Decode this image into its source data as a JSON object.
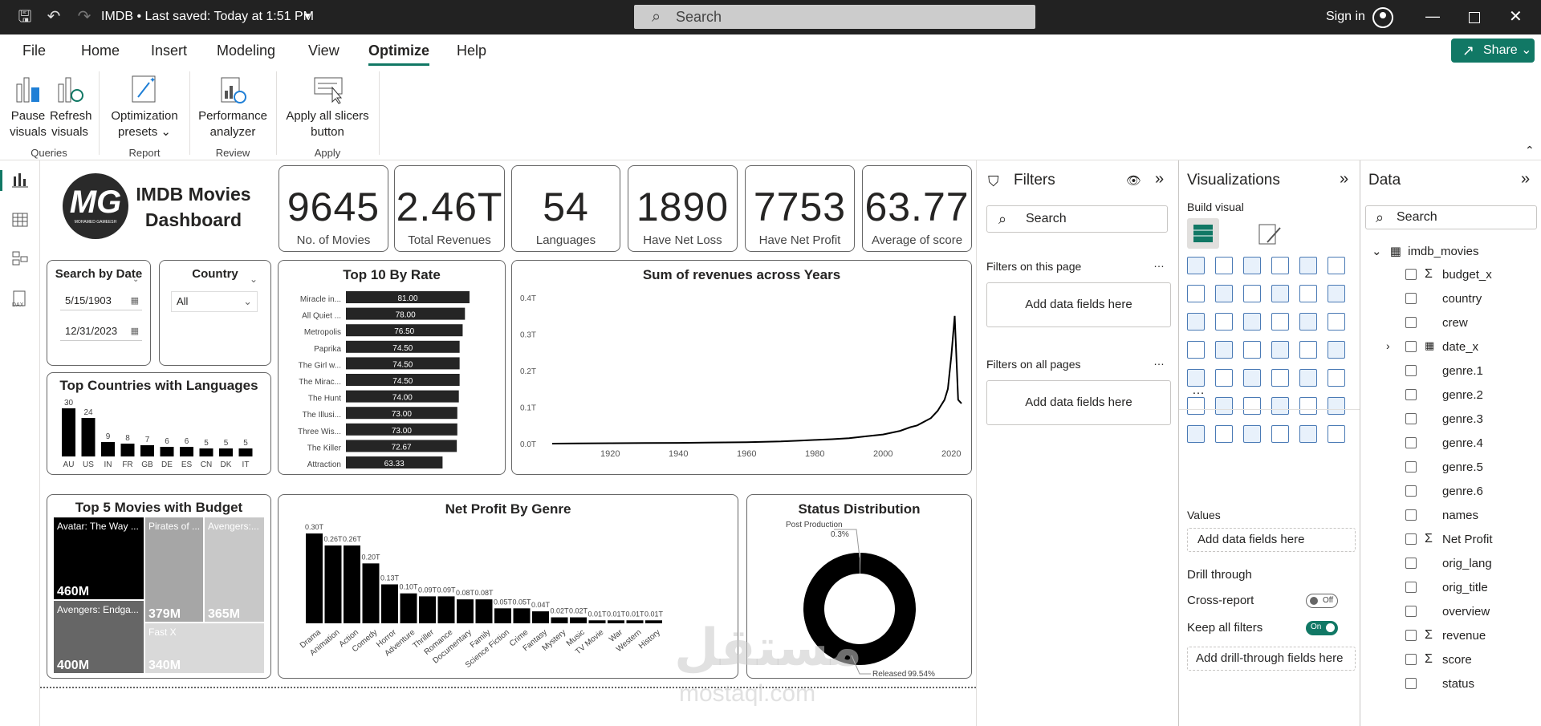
{
  "app": {
    "title": "IMDB • Last saved: Today at 1:51 PM",
    "search_placeholder": "Search",
    "signin": "Sign in"
  },
  "menu": {
    "items": [
      "File",
      "Home",
      "Insert",
      "Modeling",
      "View",
      "Optimize",
      "Help"
    ],
    "active": "Optimize",
    "share": "Share"
  },
  "ribbon": {
    "buttons": [
      {
        "line1": "Pause",
        "line2": "visuals"
      },
      {
        "line1": "Refresh",
        "line2": "visuals"
      },
      {
        "line1": "Optimization",
        "line2": "presets"
      },
      {
        "line1": "Performance",
        "line2": "analyzer"
      },
      {
        "line1": "Apply all slicers",
        "line2": "button"
      }
    ],
    "groups": [
      "Queries",
      "Report",
      "Review",
      "Apply"
    ]
  },
  "report": {
    "logo": {
      "letters": "MG",
      "subtext": "MOHAMED GAMEESH"
    },
    "title_line1": "IMDB Movies",
    "title_line2": "Dashboard",
    "kpis": [
      {
        "value": "9645",
        "label": "No. of Movies"
      },
      {
        "value": "2.46T",
        "label": "Total Revenues"
      },
      {
        "value": "54",
        "label": "Languages"
      },
      {
        "value": "1890",
        "label": "Have Net Loss"
      },
      {
        "value": "7753",
        "label": "Have Net Profit"
      },
      {
        "value": "63.77",
        "label": "Average of score"
      }
    ],
    "date_slicer": {
      "title": "Search by Date",
      "start": "5/15/1903",
      "end": "12/31/2023"
    },
    "country_slicer": {
      "title": "Country",
      "value": "All"
    }
  },
  "chart_data": [
    {
      "type": "bar",
      "orientation": "horizontal",
      "title": "Top 10 By Rate",
      "categories": [
        "Miracle in...",
        "All Quiet ...",
        "Metropolis",
        "Paprika",
        "The Girl w...",
        "The Mirac...",
        "The Hunt",
        "The Illusi...",
        "Three Wis...",
        "The Killer",
        "Attraction"
      ],
      "values": [
        81.0,
        78.0,
        76.5,
        74.5,
        74.5,
        74.5,
        74.0,
        73.0,
        73.0,
        72.67,
        63.33
      ],
      "labels": [
        "81.00",
        "78.00",
        "76.50",
        "74.50",
        "74.50",
        "74.50",
        "74.00",
        "73.00",
        "73.00",
        "72.67",
        "63.33"
      ],
      "color": "#252525"
    },
    {
      "type": "line",
      "title": "Sum of revenues across Years",
      "yticks": [
        "0.0T",
        "0.1T",
        "0.2T",
        "0.3T",
        "0.4T"
      ],
      "xticks": [
        "1920",
        "1940",
        "1960",
        "1980",
        "2000",
        "2020"
      ],
      "xlim": [
        1903,
        2023
      ],
      "ylim": [
        0,
        0.4
      ],
      "x": [
        1903,
        1910,
        1920,
        1930,
        1940,
        1950,
        1960,
        1965,
        1970,
        1975,
        1980,
        1985,
        1990,
        1995,
        2000,
        2005,
        2008,
        2010,
        2012,
        2014,
        2016,
        2018,
        2019,
        2020,
        2021,
        2022,
        2023
      ],
      "y": [
        0,
        0.0005,
        0.001,
        0.0015,
        0.002,
        0.003,
        0.004,
        0.005,
        0.006,
        0.008,
        0.01,
        0.012,
        0.015,
        0.02,
        0.025,
        0.035,
        0.045,
        0.05,
        0.06,
        0.07,
        0.09,
        0.12,
        0.15,
        0.24,
        0.35,
        0.12,
        0.11
      ]
    },
    {
      "type": "bar",
      "title": "Top Countries with Languages",
      "categories": [
        "AU",
        "US",
        "IN",
        "FR",
        "GB",
        "DE",
        "ES",
        "CN",
        "DK",
        "IT"
      ],
      "values": [
        30,
        24,
        9,
        8,
        7,
        6,
        6,
        5,
        5,
        5
      ],
      "labels": [
        "30",
        "24",
        "9",
        "8",
        "7",
        "6",
        "6",
        "5",
        "5",
        "5"
      ],
      "ylim": [
        0,
        30
      ]
    },
    {
      "type": "bar",
      "title": "Net Profit By Genre",
      "categories": [
        "Drama",
        "Animation",
        "Action",
        "Comedy",
        "Horror",
        "Adventure",
        "Thriller",
        "Romance",
        "Documentary",
        "Family",
        "Science Fiction",
        "Crime",
        "Fantasy",
        "Mystery",
        "Music",
        "TV Movie",
        "War",
        "Western",
        "History"
      ],
      "values": [
        0.3,
        0.26,
        0.26,
        0.2,
        0.13,
        0.1,
        0.09,
        0.09,
        0.08,
        0.08,
        0.05,
        0.05,
        0.04,
        0.02,
        0.02,
        0.01,
        0.01,
        0.01,
        0.01
      ],
      "labels": [
        "0.30T",
        "0.26T",
        "0.26T",
        "0.20T",
        "0.13T",
        "0.10T",
        "0.09T",
        "0.09T",
        "0.08T",
        "0.08T",
        "0.05T",
        "0.05T",
        "0.04T",
        "0.02T",
        "0.02T",
        "0.01T",
        "0.01T",
        "0.01T",
        "0.01T"
      ]
    },
    {
      "type": "pie",
      "title": "Status Distribution",
      "categories": [
        "Post Production",
        "Released"
      ],
      "values": [
        0.3,
        99.54
      ],
      "labels": [
        "0.3%",
        "99.54%"
      ]
    },
    {
      "type": "treemap",
      "title": "Top 5 Movies with Budget",
      "categories": [
        "Avatar: The Way ...",
        "Pirates of ...",
        "Avengers:...",
        "Avengers: Endga...",
        "Fast X"
      ],
      "values": [
        460,
        379,
        365,
        400,
        340
      ],
      "labels": [
        "460M",
        "379M",
        "365M",
        "400M",
        "340M"
      ],
      "colors": [
        "#000000",
        "#a6a6a6",
        "#c8c8c8",
        "#666666",
        "#d9d9d9"
      ]
    }
  ],
  "filters": {
    "title": "Filters",
    "search": "Search",
    "on_page": "Filters on this page",
    "on_all": "Filters on all pages",
    "add": "Add data fields here",
    "more": "…"
  },
  "viz": {
    "title": "Visualizations",
    "build": "Build visual",
    "more": "…",
    "values": "Values",
    "add_data": "Add data fields here",
    "drill": "Drill through",
    "cross": "Cross-report",
    "cross_state": "Off",
    "keep": "Keep all filters",
    "keep_state": "On",
    "add_drill": "Add drill-through fields here"
  },
  "data": {
    "title": "Data",
    "search": "Search",
    "table": "imdb_movies",
    "fields": [
      {
        "name": "budget_x",
        "sigma": true
      },
      {
        "name": "country",
        "sigma": false
      },
      {
        "name": "crew",
        "sigma": false
      },
      {
        "name": "date_x",
        "sigma": false,
        "expand": true
      },
      {
        "name": "genre.1",
        "sigma": false
      },
      {
        "name": "genre.2",
        "sigma": false
      },
      {
        "name": "genre.3",
        "sigma": false
      },
      {
        "name": "genre.4",
        "sigma": false
      },
      {
        "name": "genre.5",
        "sigma": false
      },
      {
        "name": "genre.6",
        "sigma": false
      },
      {
        "name": "names",
        "sigma": false
      },
      {
        "name": "Net Profit",
        "sigma": true
      },
      {
        "name": "orig_lang",
        "sigma": false
      },
      {
        "name": "orig_title",
        "sigma": false
      },
      {
        "name": "overview",
        "sigma": false
      },
      {
        "name": "revenue",
        "sigma": true
      },
      {
        "name": "score",
        "sigma": true
      },
      {
        "name": "status",
        "sigma": false
      }
    ]
  },
  "watermark": {
    "arabic": "مستقل",
    "latin": "mostaql.com"
  }
}
